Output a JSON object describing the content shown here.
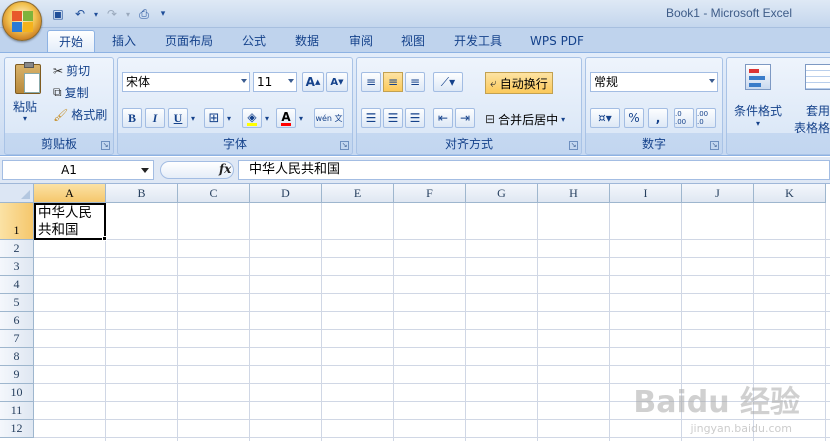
{
  "window": {
    "title": "Book1 - Microsoft Excel"
  },
  "tabs": [
    "开始",
    "插入",
    "页面布局",
    "公式",
    "数据",
    "审阅",
    "视图",
    "开发工具",
    "WPS PDF"
  ],
  "clipboard": {
    "paste": "粘贴",
    "cut": "剪切",
    "copy": "复制",
    "format_painter": "格式刷",
    "label": "剪贴板"
  },
  "font": {
    "name": "宋体",
    "size": "11",
    "grow": "A",
    "shrink": "A",
    "bold": "B",
    "italic": "I",
    "underline": "U",
    "font_color_letter": "A",
    "phonetic": "wén 文",
    "label": "字体"
  },
  "alignment": {
    "wrap_text": "自动换行",
    "merge_center": "合并后居中",
    "label": "对齐方式"
  },
  "number": {
    "format": "常规",
    "percent": "%",
    "comma": ",",
    "inc_decimal": ".0 .00",
    "dec_decimal": ".00 .0",
    "label": "数字"
  },
  "styles": {
    "conditional": "条件格式",
    "table": "套用",
    "table2": "表格格式"
  },
  "formula_bar": {
    "name_box": "A1",
    "fx": "fx",
    "content": "中华人民共和国"
  },
  "grid": {
    "columns": [
      "A",
      "B",
      "C",
      "D",
      "E",
      "F",
      "G",
      "H",
      "I",
      "J",
      "K"
    ],
    "rows": [
      "1",
      "2",
      "3",
      "4",
      "5",
      "6",
      "7",
      "8",
      "9",
      "10",
      "11",
      "12"
    ],
    "cell_a1": "中华人民共和国"
  },
  "watermark": {
    "brand": "Baidu 经验",
    "url": "jingyan.baidu.com"
  },
  "colors": {
    "selection_header": "#f5c76c",
    "ribbon": "#d3e1f4",
    "tab_text": "#15428b"
  }
}
